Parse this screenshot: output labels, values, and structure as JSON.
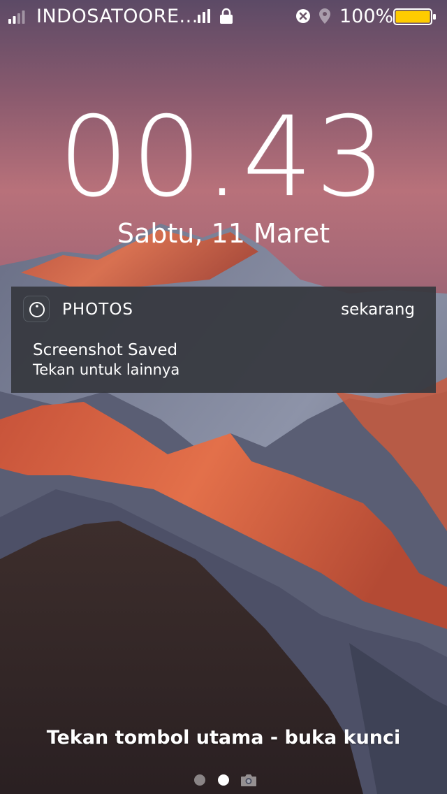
{
  "status_bar": {
    "carrier": "INDOSATOORE...",
    "battery_percent": "100%",
    "signal_bars_filled": 2,
    "battery_level": 1.0,
    "battery_color": "#ffcc00"
  },
  "lock_screen": {
    "time": "00.43",
    "date": "Sabtu, 11 Maret"
  },
  "notification": {
    "app_name": "PHOTOS",
    "time": "sekarang",
    "title": "Screenshot Saved",
    "body": "Tekan untuk lainnya",
    "icon": "photos-icon"
  },
  "footer": {
    "unlock_hint": "Tekan tombol utama - buka kunci",
    "page_count": 2,
    "current_page": 2,
    "camera_icon": "camera-icon"
  }
}
